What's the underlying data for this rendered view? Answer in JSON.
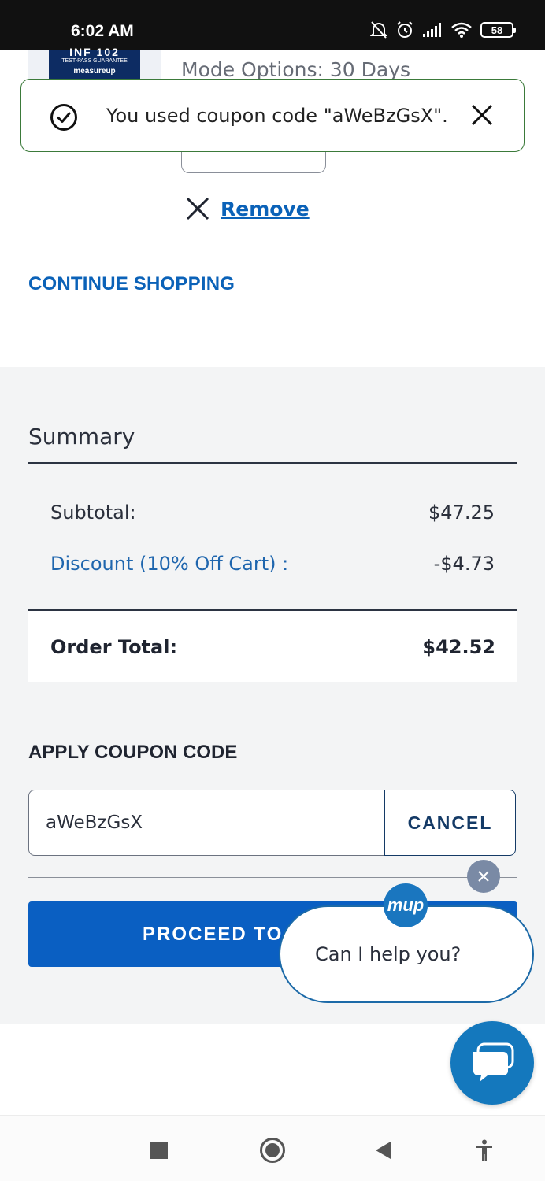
{
  "status_bar": {
    "time": "6:02 AM",
    "battery": "58"
  },
  "product": {
    "thumb_title": "INF 102",
    "thumb_subtitle": "TEST-PASS GUARANTEE",
    "thumb_brand": "measureup",
    "mode_options": "Mode Options: 30 Days"
  },
  "toast": {
    "message": "You used coupon code \"aWeBzGsX\"."
  },
  "cart": {
    "remove_label": "Remove",
    "continue_shopping": "CONTINUE SHOPPING"
  },
  "summary": {
    "title": "Summary",
    "subtotal_label": "Subtotal:",
    "subtotal_value": "$47.25",
    "discount_label": "Discount (10% Off Cart) :",
    "discount_value": "-$4.73",
    "order_total_label": "Order Total:",
    "order_total_value": "$42.52"
  },
  "coupon": {
    "heading": "APPLY COUPON CODE",
    "value": "aWeBzGsX",
    "cancel_label": "CANCEL"
  },
  "checkout": {
    "proceed_label": "PROCEED TO"
  },
  "chat": {
    "prompt": "Can I help you?",
    "logo_text": "mup"
  },
  "colors": {
    "brand_blue": "#0a5fc2",
    "link_blue": "#0b62b8",
    "toast_border": "#3b7a3a"
  }
}
